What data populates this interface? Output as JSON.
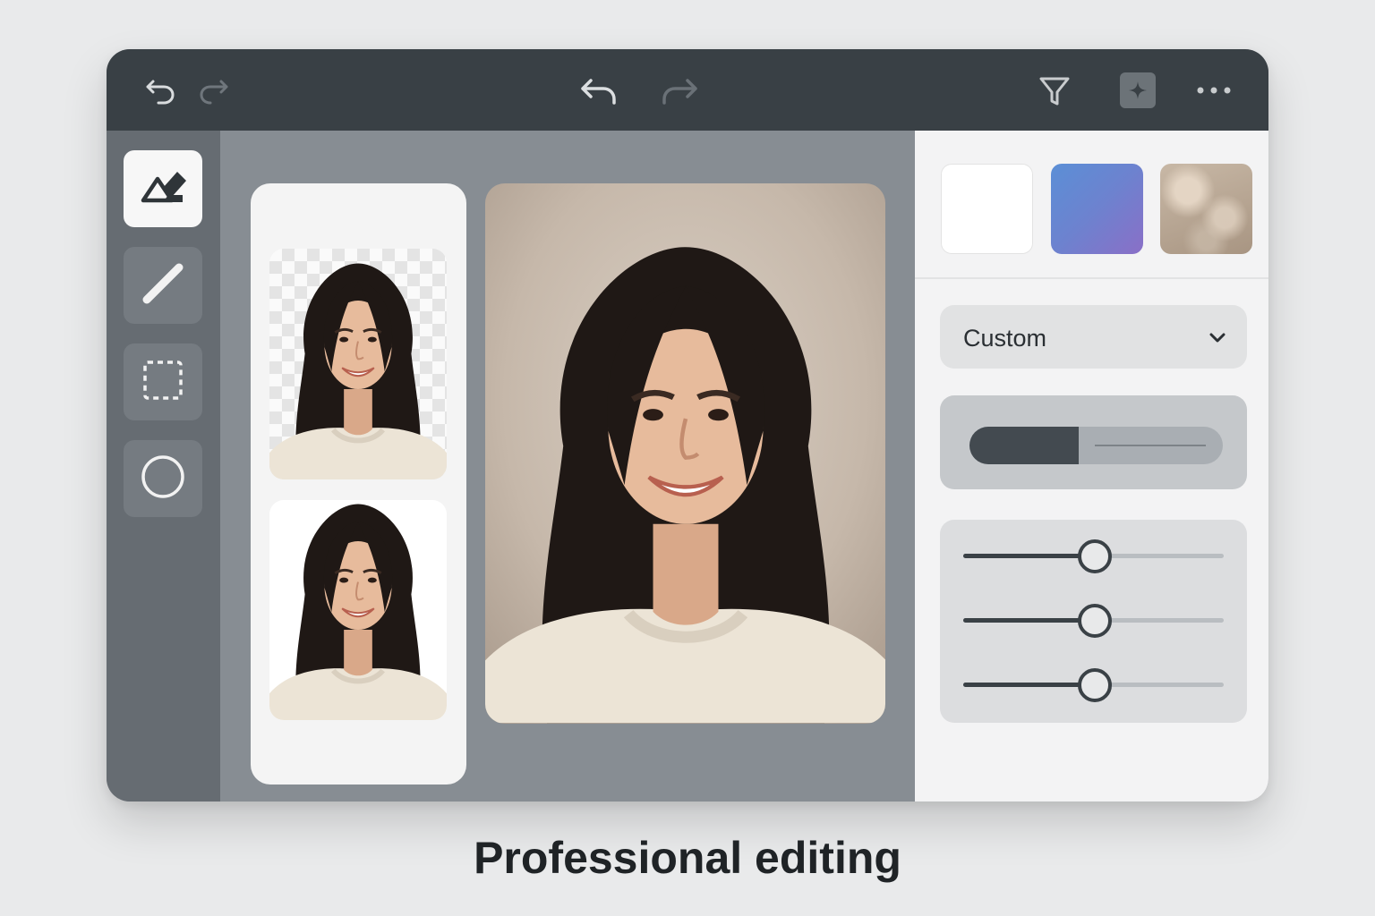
{
  "toolbar": {
    "left_icons": [
      "undo-icon",
      "redo-icon"
    ],
    "center_icons": [
      "undo-icon",
      "redo-icon"
    ],
    "right_icons": [
      "filter-icon",
      "sparkle-icon",
      "more-icon"
    ]
  },
  "tools": [
    {
      "name": "eraser-tool",
      "icon": "eraser-icon",
      "active": true
    },
    {
      "name": "brush-tool",
      "icon": "brush-icon",
      "active": false
    },
    {
      "name": "marquee-select-tool",
      "icon": "dashed-rectangle-icon",
      "active": false
    },
    {
      "name": "ellipse-select-tool",
      "icon": "circle-icon",
      "active": false
    }
  ],
  "thumbnails": [
    {
      "name": "transparent-background-thumbnail",
      "background": "checkerboard"
    },
    {
      "name": "white-background-thumbnail",
      "background": "white"
    }
  ],
  "main_photo": {
    "name": "main-portrait",
    "background": "beige-blur"
  },
  "panel": {
    "swatches": [
      {
        "name": "white-background-swatch",
        "color": "#ffffff"
      },
      {
        "name": "gradient-background-swatch",
        "color": "#6d82cf"
      },
      {
        "name": "bokeh-background-swatch",
        "color": "#b8a794"
      }
    ],
    "preset_dropdown": {
      "value": "Custom",
      "icon": "chevron-down-icon"
    },
    "toggle_fill_fraction": 0.43,
    "sliders": [
      {
        "name": "slider-1",
        "value": 0.5
      },
      {
        "name": "slider-2",
        "value": 0.5
      },
      {
        "name": "slider-3",
        "value": 0.5
      }
    ]
  },
  "colors": {
    "topbar": "#394045",
    "sidebar": "#666c72",
    "canvas": "#878d93",
    "panel": "#f3f3f4",
    "accent_dark": "#3a4146"
  },
  "caption": "Professional editing"
}
